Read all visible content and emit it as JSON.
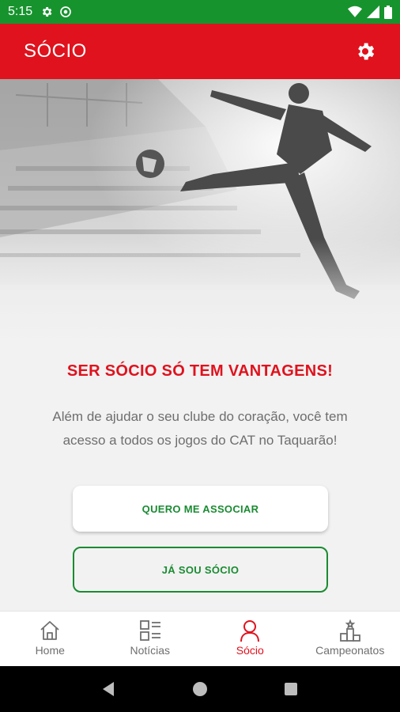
{
  "status_bar": {
    "time": "5:15"
  },
  "app_bar": {
    "title": "SÓCIO"
  },
  "main": {
    "headline": "SER SÓCIO SÓ TEM VANTAGENS!",
    "description": "Além de ajudar o seu clube do coração, você tem acesso a todos os jogos do CAT no Taquarão!",
    "primary_button": "QUERO ME ASSOCIAR",
    "secondary_button": "JÁ SOU SÓCIO"
  },
  "bottom_nav": {
    "items": [
      {
        "label": "Home",
        "icon": "home-icon"
      },
      {
        "label": "Notícias",
        "icon": "news-icon"
      },
      {
        "label": "Sócio",
        "icon": "person-icon",
        "active": true
      },
      {
        "label": "Campeonatos",
        "icon": "podium-icon"
      }
    ]
  },
  "colors": {
    "primary_red": "#e0121d",
    "status_green": "#17932e",
    "button_green": "#1a8b32"
  }
}
